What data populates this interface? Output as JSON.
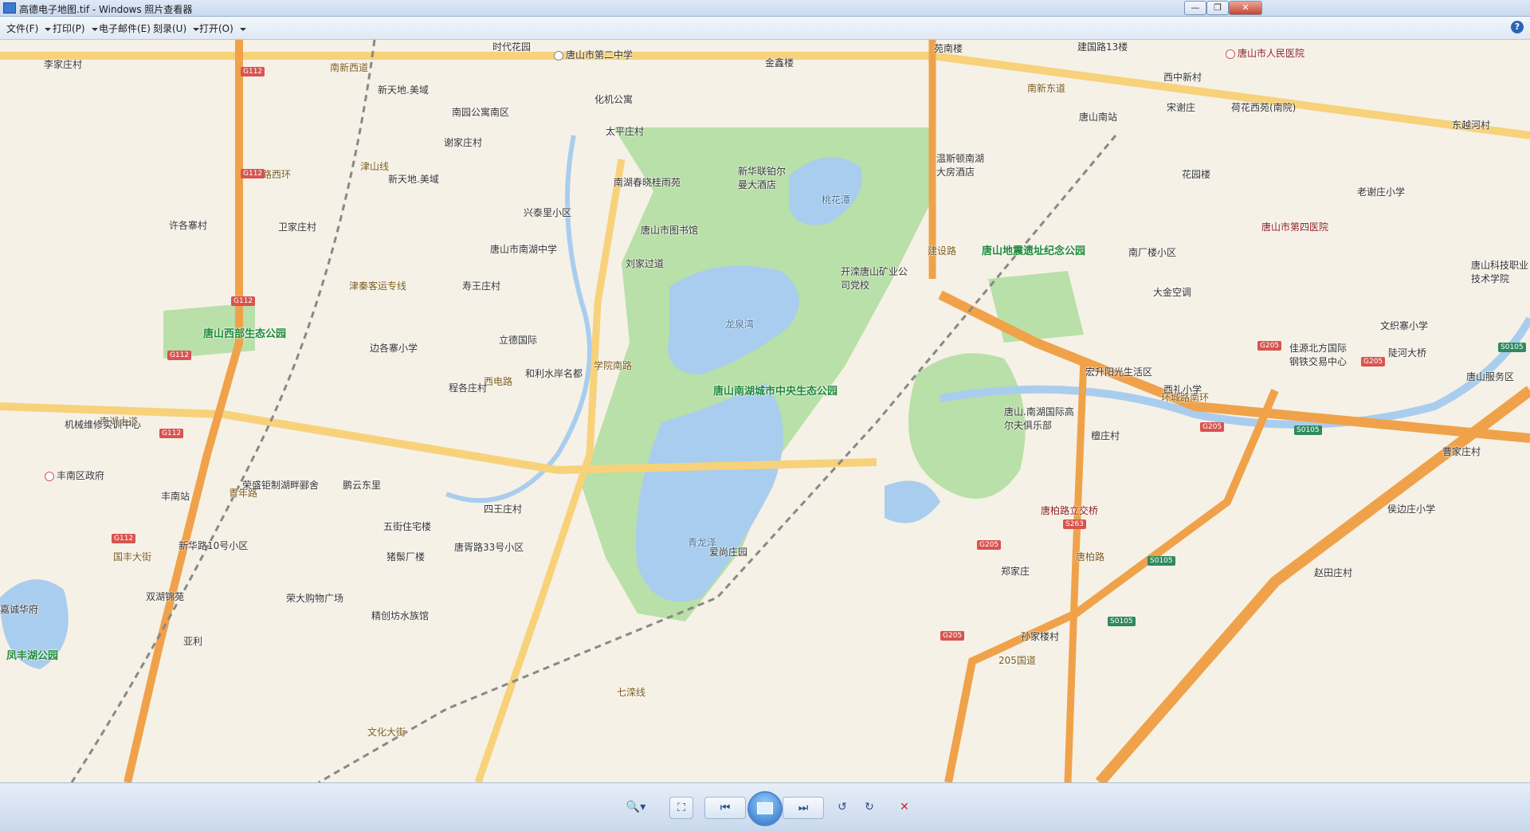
{
  "window": {
    "title": "高德电子地图.tif - Windows 照片查看器",
    "minimize_label": "—",
    "maximize_label": "❐",
    "close_label": "✕"
  },
  "menubar": {
    "items": [
      "文件(F)",
      "打印(P)",
      "电子邮件(E)",
      "刻录(U)",
      "打开(O)"
    ],
    "help_label": "?"
  },
  "map": {
    "parks": [
      "唐山南湖城市中央生态公园",
      "唐山地震遗址纪念公园",
      "唐山西部生态公园",
      "凤丰湖公园"
    ],
    "water": [
      "龙泉湾",
      "青龙泽",
      "桃花潭"
    ],
    "roads": [
      "南新西道",
      "南新东道",
      "南湖大道",
      "环城路南环",
      "环城路西环",
      "学院南路",
      "建设路",
      "西电路",
      "唐柏路",
      "205国道",
      "青年路",
      "文化大街",
      "国丰大街",
      "七滦线",
      "津山线",
      "津秦客运专线"
    ],
    "places": [
      "时代花园",
      "唐山市第二中学",
      "金鑫楼",
      "苑南楼",
      "建国路13楼",
      "唐山市人民医院",
      "李家庄村",
      "新天地.美域",
      "化机公寓",
      "南园公寓南区",
      "谢家庄村",
      "太平庄村",
      "新天地.美域",
      "新华联铂尔曼大酒店",
      "温斯顿南湖大房酒店",
      "西中新村",
      "宋谢庄",
      "荷花西苑(南院)",
      "唐山南站",
      "东越河村",
      "南湖春晓桂雨苑",
      "兴泰里小区",
      "唐山市图书馆",
      "花园楼",
      "老谢庄小学",
      "唐山市第四医院",
      "许各寨村",
      "卫家庄村",
      "唐山市南湖中学",
      "刘家过道",
      "开滦唐山矿业公司党校",
      "南厂楼小区",
      "唐山科技职业技术学院",
      "寿王庄村",
      "大金空调",
      "边各寨小学",
      "立德国际",
      "文织寨小学",
      "佳源北方国际钢铁交易中心",
      "陡河大桥",
      "唐山服务区",
      "和利水岸名都",
      "宏升阳光生活区",
      "程各庄村",
      "西礼小学",
      "机械维修实训中心",
      "唐山.南湖国际高尔夫俱乐部",
      "檀庄村",
      "丰南区政府",
      "曹家庄村",
      "荣盛钜制湖畔郦舍",
      "鹏云东里",
      "丰南站",
      "四王庄村",
      "唐柏路立交桥",
      "侯边庄小学",
      "五街住宅楼",
      "新华路10号小区",
      "唐胥路33号小区",
      "爱尚庄园",
      "郑家庄",
      "赵田庄村",
      "猪鬃厂楼",
      "双湖锦苑",
      "荣大购物广场",
      "嘉诚华府",
      "精创坊水族馆",
      "孙家楼村",
      "亚利"
    ],
    "shields": [
      "G112",
      "G205",
      "S263",
      "S0105"
    ],
    "colors": {
      "land": "#f6f1e6",
      "park": "#b8e0a8",
      "water": "#a9cdee",
      "highway": "#f0a24a",
      "arterial": "#f7d27a",
      "railway": "#888888"
    }
  },
  "toolbar": {
    "zoom_label": "🔍▾",
    "fit_label": "⛶",
    "prev_label": "⏮",
    "next_label": "⏭",
    "rotate_ccw_label": "↺",
    "rotate_cw_label": "↻",
    "delete_label": "✕"
  }
}
